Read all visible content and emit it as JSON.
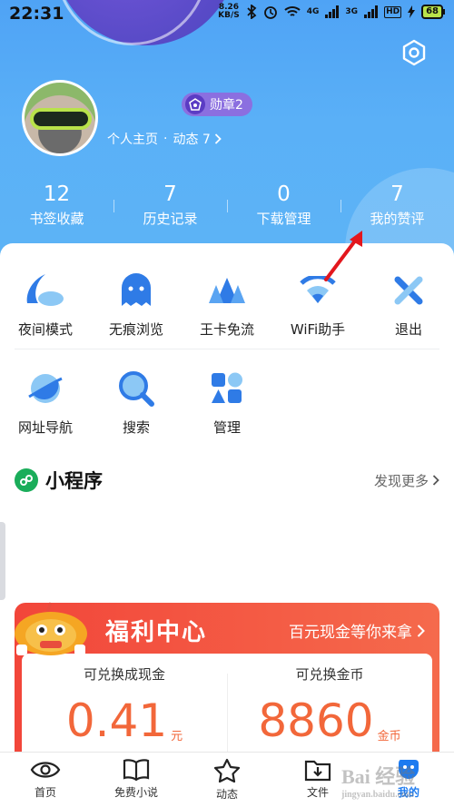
{
  "status_bar": {
    "time": "22:31",
    "net_speed_value": "8.26",
    "net_speed_unit": "KB/S",
    "sig1": "4G",
    "sig2": "3G",
    "battery": "68"
  },
  "profile": {
    "badge": "勋章2",
    "home_label": "个人主页",
    "dynamic_label": "动态 7",
    "sep": "·"
  },
  "stats": [
    {
      "num": "12",
      "label": "书签收藏"
    },
    {
      "num": "7",
      "label": "历史记录"
    },
    {
      "num": "0",
      "label": "下载管理"
    },
    {
      "num": "7",
      "label": "我的赞评"
    }
  ],
  "tools_row1": [
    {
      "label": "夜间模式",
      "icon": "moon-icon"
    },
    {
      "label": "无痕浏览",
      "icon": "ghost-icon"
    },
    {
      "label": "王卡免流",
      "icon": "crown-icon"
    },
    {
      "label": "WiFi助手",
      "icon": "wifi-icon"
    },
    {
      "label": "退出",
      "icon": "close-icon"
    }
  ],
  "tools_row2": [
    {
      "label": "网址导航",
      "icon": "planet-icon"
    },
    {
      "label": "搜索",
      "icon": "search-icon"
    },
    {
      "label": "管理",
      "icon": "apps-icon"
    }
  ],
  "mini_program": {
    "title": "小程序",
    "more": "发现更多"
  },
  "welfare": {
    "title": "福利中心",
    "subtitle": "百元现金等你来拿",
    "cash_label": "可兑换成现金",
    "cash_value": "0.41",
    "cash_unit": "元",
    "coin_label": "可兑换金币",
    "coin_value": "8860",
    "coin_unit": "金币"
  },
  "bottom_nav": [
    {
      "label": "首页",
      "icon": "eye-icon"
    },
    {
      "label": "免费小说",
      "icon": "book-icon"
    },
    {
      "label": "动态",
      "icon": "star-icon"
    },
    {
      "label": "文件",
      "icon": "download-folder-icon"
    },
    {
      "label": "我的",
      "icon": "user-icon"
    }
  ],
  "watermark": {
    "main": "Bai 经验",
    "sub": "jingyan.baidu.com"
  },
  "colors": {
    "accent": "#1d7bf0",
    "header": "#5ab0f7",
    "welfare": "#f2463a",
    "value": "#f2673a"
  }
}
